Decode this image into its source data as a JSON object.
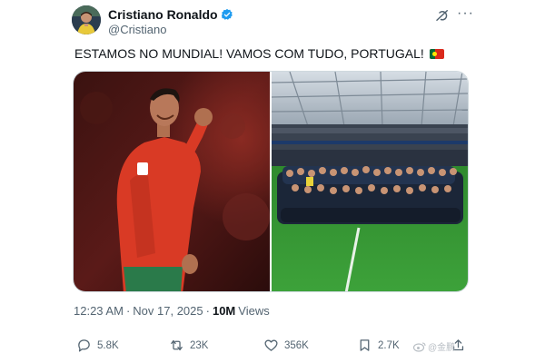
{
  "author": {
    "display_name": "Cristiano Ronaldo",
    "handle": "@Cristiano",
    "avatar_icon": "profile-photo",
    "verified_color": "#1d9bf0"
  },
  "header_icons": [
    "grok-icon",
    "more-icon"
  ],
  "tweet": {
    "text": "ESTAMOS NO MUNDIAL! VAMOS COM TUDO, PORTUGAL!",
    "emoji": "portugal-flag"
  },
  "media": [
    {
      "alt_icon": "ronaldo-celebrating-photo"
    },
    {
      "alt_icon": "team-celebration-stadium-photo"
    }
  ],
  "meta": {
    "time": "12:23 AM",
    "separator": "·",
    "date": "Nov 17, 2025",
    "separator2": "·",
    "views_count": "10M",
    "views_label": "Views"
  },
  "actions": {
    "replies": "5.8K",
    "reposts": "23K",
    "likes": "356K",
    "bookmarks": "2.7K"
  },
  "watermark": {
    "text": "@金鹏"
  },
  "colors": {
    "text": "#0f1419",
    "secondary": "#536471",
    "border": "#cfd9de"
  }
}
